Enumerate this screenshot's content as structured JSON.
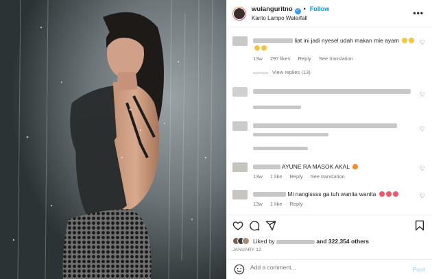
{
  "header": {
    "username": "wulanguritno",
    "follow_label": "Follow",
    "dot": "•",
    "location": "Kanto Lampo Waterfall",
    "more": "•••"
  },
  "comments": [
    {
      "text": "liat ini jadi nyesel udah makan mie ayam",
      "time": "13w",
      "likes": "297 likes",
      "reply": "Reply",
      "translate": "See translation",
      "view_replies": "View replies (13)"
    },
    {
      "text": "",
      "time": "",
      "likes": "",
      "reply": "",
      "translate": ""
    },
    {
      "text": "",
      "time": "",
      "likes": "",
      "reply": "",
      "translate": ""
    },
    {
      "text": "AYUNE RA MASOK AKAL",
      "time": "13w",
      "likes": "1 like",
      "reply": "Reply",
      "translate": "See translation"
    },
    {
      "text": "Mi nangissss ga tuh wanita wanita",
      "time": "13w",
      "likes": "1 like",
      "reply": "Reply"
    }
  ],
  "likes": {
    "prefix": "Liked by",
    "suffix": "and 322,354 others"
  },
  "date": "JANUARY 12",
  "add_comment": {
    "placeholder": "Add a comment...",
    "post_label": "Post"
  },
  "colors": {
    "link": "#0095f6",
    "post_disabled": "#b3dbff",
    "muted": "#737373"
  },
  "icons": [
    "heart-icon",
    "comment-icon",
    "share-icon",
    "bookmark-icon",
    "emoji-icon",
    "more-icon",
    "verified-icon"
  ]
}
